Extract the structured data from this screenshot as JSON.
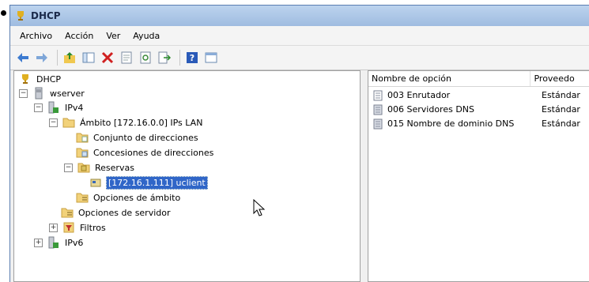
{
  "window": {
    "title": "DHCP"
  },
  "menu": [
    "Archivo",
    "Acción",
    "Ver",
    "Ayuda"
  ],
  "toolbar": [
    "back-icon",
    "forward-icon",
    "up-folder-icon",
    "show-tree-icon",
    "delete-icon",
    "properties-icon",
    "refresh-icon",
    "export-icon",
    "help-icon",
    "console-icon"
  ],
  "tree": {
    "root": "DHCP",
    "server": "wserver",
    "ipv4": "IPv4",
    "scope": "Ámbito [172.16.0.0] IPs LAN",
    "pool": "Conjunto de direcciones",
    "leases": "Concesiones de direcciones",
    "reservations": "Reservas",
    "reservation_item": "[172.16.1.111] uclient",
    "scope_options": "Opciones de ámbito",
    "server_options": "Opciones de servidor",
    "filters": "Filtros",
    "ipv6": "IPv6"
  },
  "list": {
    "columns": [
      "Nombre de opción",
      "Proveedo"
    ],
    "rows": [
      {
        "name": "003 Enrutador",
        "vendor": "Estándar"
      },
      {
        "name": "006 Servidores DNS",
        "vendor": "Estándar"
      },
      {
        "name": "015 Nombre de dominio DNS",
        "vendor": "Estándar"
      }
    ]
  },
  "colors": {
    "selection": "#3066c8",
    "titlebar": "#9fbce0"
  }
}
